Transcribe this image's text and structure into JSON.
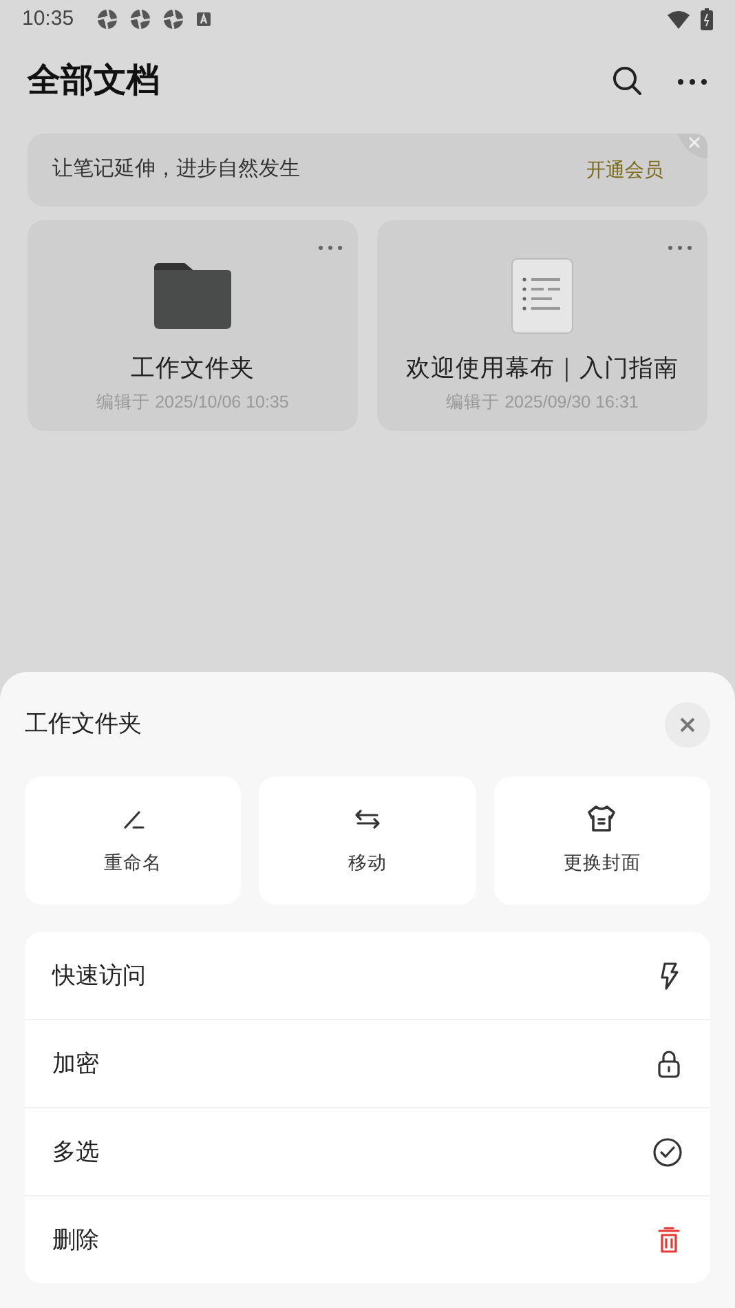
{
  "status_bar": {
    "time": "10:35",
    "notification_icons": [
      {
        "kind": "app"
      },
      {
        "kind": "app"
      },
      {
        "kind": "app"
      },
      {
        "kind": "keyboard"
      }
    ]
  },
  "header": {
    "title": "全部文档"
  },
  "banner": {
    "text": "让笔记延伸，进步自然发生",
    "action": "开通会员"
  },
  "documents": [
    {
      "kind": "folder",
      "name": "工作文件夹",
      "edited": "编辑于 2025/10/06 10:35"
    },
    {
      "kind": "document",
      "name": "欢迎使用幕布｜入门指南",
      "edited": "编辑于 2025/09/30 16:31"
    }
  ],
  "sheet": {
    "title": "工作文件夹",
    "actions": [
      {
        "kind": "rename",
        "label": "重命名"
      },
      {
        "kind": "move",
        "label": "移动"
      },
      {
        "kind": "cover",
        "label": "更换封面"
      }
    ],
    "menu": [
      {
        "kind": "quick",
        "label": "快速访问"
      },
      {
        "kind": "lock",
        "label": "加密"
      },
      {
        "kind": "multi",
        "label": "多选"
      },
      {
        "kind": "delete",
        "label": "删除"
      }
    ]
  }
}
